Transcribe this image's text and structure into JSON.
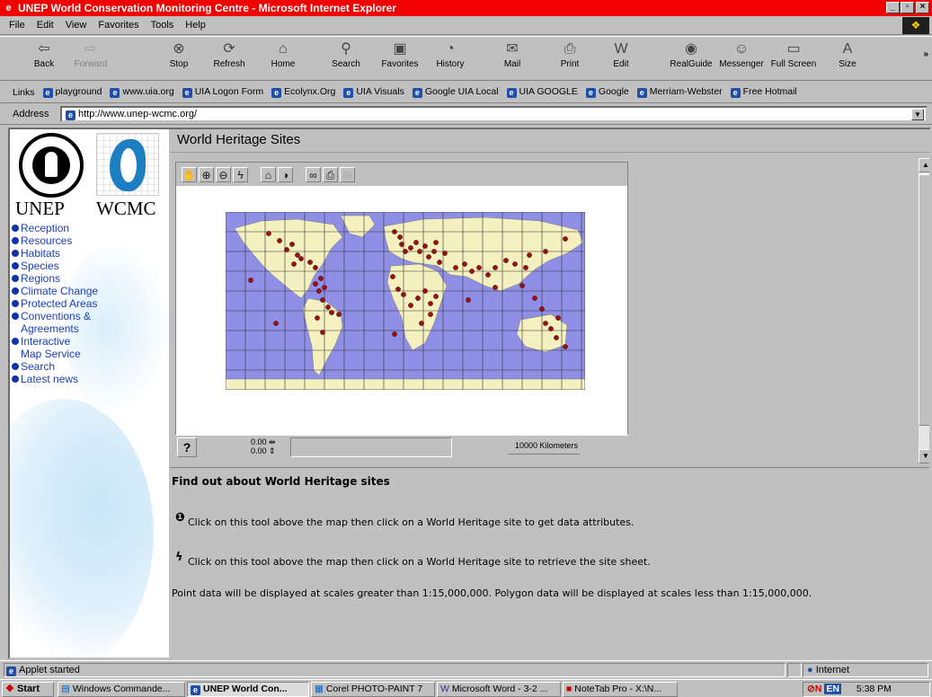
{
  "window": {
    "title": "UNEP World Conservation Monitoring Centre - Microsoft Internet Explorer"
  },
  "menu": [
    "File",
    "Edit",
    "View",
    "Favorites",
    "Tools",
    "Help"
  ],
  "toolbar": [
    {
      "label": "Back",
      "icon": "back-arrow-icon"
    },
    {
      "label": "Forward",
      "icon": "forward-arrow-icon"
    },
    {
      "label": "Stop",
      "icon": "stop-icon"
    },
    {
      "label": "Refresh",
      "icon": "refresh-icon"
    },
    {
      "label": "Home",
      "icon": "home-icon"
    },
    {
      "label": "Search",
      "icon": "search-icon"
    },
    {
      "label": "Favorites",
      "icon": "favorites-icon"
    },
    {
      "label": "History",
      "icon": "history-icon"
    },
    {
      "label": "Mail",
      "icon": "mail-icon"
    },
    {
      "label": "Print",
      "icon": "print-icon"
    },
    {
      "label": "Edit",
      "icon": "edit-icon"
    },
    {
      "label": "RealGuide",
      "icon": "realguide-icon"
    },
    {
      "label": "Messenger",
      "icon": "messenger-icon"
    },
    {
      "label": "Full Screen",
      "icon": "fullscreen-icon"
    },
    {
      "label": "Size",
      "icon": "size-icon"
    }
  ],
  "links": {
    "label": "Links",
    "items": [
      "playground",
      "www.uia.org",
      "UIA Logon Form",
      "Ecolynx.Org",
      "UIA Visuals",
      "Google UIA Local",
      "UIA GOOGLE",
      "Google",
      "Merriam-Webster",
      "Free Hotmail"
    ]
  },
  "address": {
    "label": "Address",
    "url": "http://www.unep-wcmc.org/"
  },
  "sidebar": {
    "logo_left": "UNEP",
    "logo_right": "WCMC",
    "nav": [
      {
        "label": "Reception"
      },
      {
        "label": "Resources"
      },
      {
        "label": "Habitats"
      },
      {
        "label": "Species"
      },
      {
        "label": "Regions"
      },
      {
        "label": "Climate Change"
      },
      {
        "label": "Protected Areas"
      },
      {
        "label": "Conventions &",
        "cont": "Agreements"
      },
      {
        "label": "Interactive",
        "cont": "Map Service"
      },
      {
        "label": "Search"
      },
      {
        "label": "Latest news"
      }
    ]
  },
  "page": {
    "title": "World Heritage Sites"
  },
  "map": {
    "tools": [
      "pan-tool-icon",
      "zoom-in-icon",
      "zoom-out-icon",
      "lightning-icon",
      "home-tool-icon",
      "info-tool-icon",
      "binoculars-icon",
      "print-tool-icon",
      "disabled-tool-icon"
    ],
    "help": "?",
    "coord_x": "0.00",
    "coord_y": "0.00",
    "scale": "10000 Kilometers"
  },
  "info": {
    "heading": "Find out about World Heritage sites",
    "line1": "Click on this tool above the map then click on a World Heritage site to get data attributes.",
    "line2": "Click on this tool above the map then click on a World Heritage site to retrieve the site sheet.",
    "para": "Point data will be displayed at scales greater than 1:15,000,000. Polygon data will be displayed at scales less than 1:15,000,000."
  },
  "status": {
    "text": "Applet started",
    "zone": "Internet"
  },
  "taskbar": {
    "start": "Start",
    "tasks": [
      "Windows Commande...",
      "UNEP World Con...",
      "Corel PHOTO-PAINT 7",
      "Microsoft Word - 3-2 ...",
      "NoteTab Pro - X:\\N..."
    ],
    "lang": "EN",
    "time": "5:38 PM"
  },
  "colors": {
    "titlebar": "#f00000",
    "ocean": "#8f8fe6",
    "land": "#f4f0c0",
    "site": "#9b1010",
    "link": "#1d3fb5"
  }
}
